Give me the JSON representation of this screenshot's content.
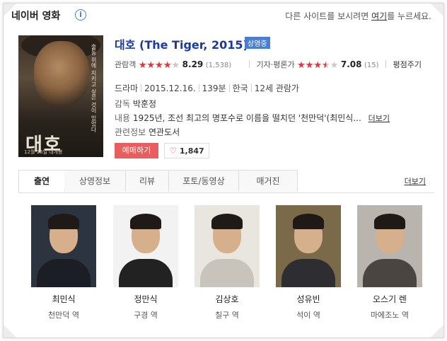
{
  "header": {
    "title": "네이버 영화",
    "info_icon": "i",
    "notice_prefix": "다른 사이트를 보시려면",
    "notice_link": "여기",
    "notice_suffix": "를 누르세요."
  },
  "movie": {
    "title": "대호 (The Tiger, 2015)",
    "status": "상영중",
    "poster": {
      "title_text": "대호",
      "tagline": "출동 위에 지키고 싶은 것이 있었다",
      "release_text": "12월 16일 대개봉"
    },
    "audience": {
      "label": "관람객",
      "score": "8.29",
      "count": "(1,538)",
      "stars": 0.829
    },
    "critic": {
      "label": "기자·평론가",
      "score": "7.08",
      "count": "(15)",
      "stars": 0.708,
      "link": "평점주기"
    },
    "genre": "드라마",
    "release": "2015.12.16.",
    "runtime": "139분",
    "country": "한국",
    "rating": "12세 관람가",
    "director_label": "감독",
    "director": "박훈정",
    "synopsis_label": "내용",
    "synopsis": "1925년, 조선 최고의 명포수로 이름을 떨치던 '천만덕'(최민식...",
    "synopsis_more": "더보기",
    "related_label": "관련정보",
    "related": "연관도서",
    "book_button": "예매하기",
    "likes": "1,847",
    "heart_icon": "♡"
  },
  "tabs": [
    {
      "label": "출연",
      "active": true
    },
    {
      "label": "상영정보"
    },
    {
      "label": "리뷰"
    },
    {
      "label": "포토/동영상"
    },
    {
      "label": "매거진"
    }
  ],
  "tabs_more": "더보기",
  "cast": [
    {
      "name": "최민식",
      "role": "천만덕 역",
      "bg": "#2c3440",
      "suit": "#1b1e24"
    },
    {
      "name": "정만식",
      "role": "구경 역",
      "bg": "#f2f2f2",
      "suit": "#222"
    },
    {
      "name": "김상호",
      "role": "칠구 역",
      "bg": "#e9e6e0",
      "suit": "#c9c4bb"
    },
    {
      "name": "성유빈",
      "role": "석이 역",
      "bg": "#7a6a4a",
      "suit": "#2d2d32"
    },
    {
      "name": "오스기 렌",
      "role": "마에조노 역",
      "bg": "#b9b4ad",
      "suit": "#4a4540"
    }
  ]
}
